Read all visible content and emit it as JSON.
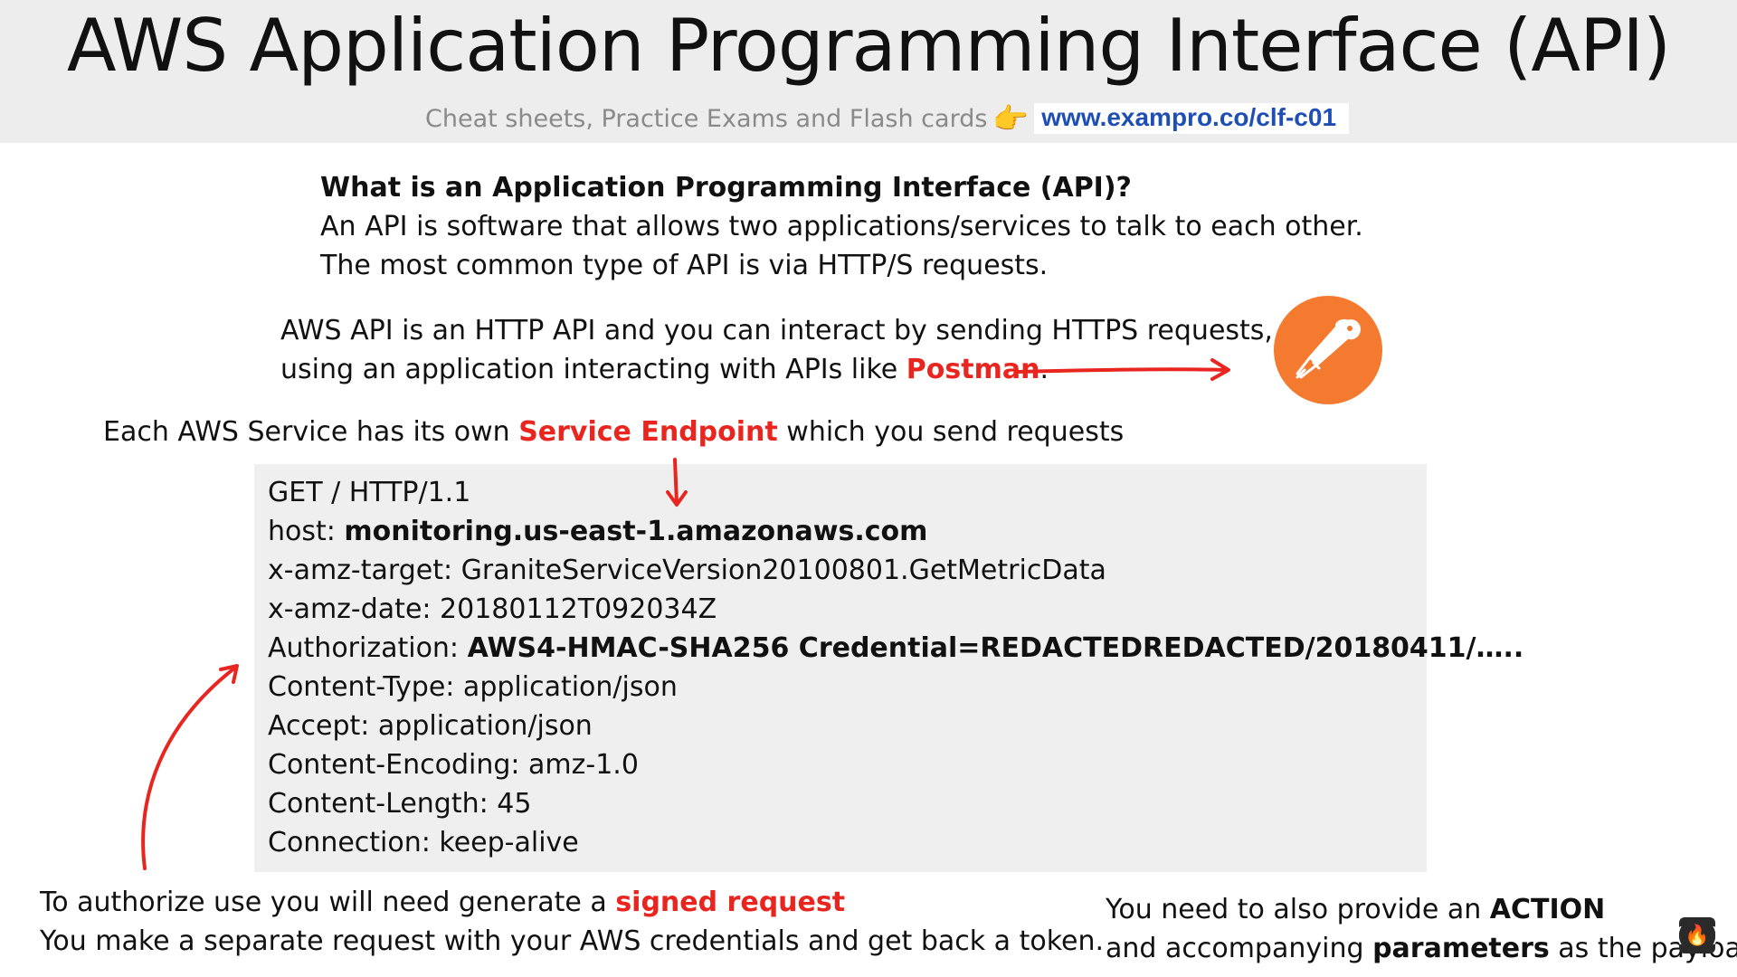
{
  "header": {
    "title": "AWS Application Programming Interface (API)",
    "subtitle": "Cheat sheets, Practice Exams and Flash cards",
    "link": "www.exampro.co/clf-c01"
  },
  "intro": {
    "heading": "What is an Application Programming Interface (API)?",
    "line1": "An API is software that allows two applications/services to talk to each other.",
    "line2": "The most common type of API is via HTTP/S requests."
  },
  "aws_api": {
    "line1": "AWS API is an HTTP API and you can interact by sending HTTPS requests,",
    "line2_prefix": "using an application interacting with APIs like ",
    "line2_highlight": "Postman",
    "line2_suffix": "."
  },
  "service": {
    "prefix": "Each AWS Service has its own ",
    "highlight": "Service Endpoint",
    "suffix": " which you send requests"
  },
  "request": {
    "line1": "GET / HTTP/1.1",
    "host_label": "host: ",
    "host_value": "monitoring.us-east-1.amazonaws.com",
    "target": "x-amz-target: GraniteServiceVersion20100801.GetMetricData",
    "date": "x-amz-date: 20180112T092034Z",
    "auth_label": "Authorization: ",
    "auth_value": "AWS4-HMAC-SHA256 Credential=REDACTEDREDACTED/20180411/…..",
    "content_type": "Content-Type: application/json",
    "accept": "Accept: application/json",
    "encoding": "Content-Encoding: amz-1.0",
    "length": "Content-Length: 45",
    "connection": "Connection: keep-alive"
  },
  "authorize": {
    "line1_prefix": "To authorize use you will need generate a ",
    "line1_highlight": "signed request",
    "line2": "You make a separate request with your AWS credentials and get back a token."
  },
  "action": {
    "line1_prefix": "You need to also provide an ",
    "line1_bold": "ACTION",
    "line2_prefix": "and accompanying ",
    "line2_bold": "parameters",
    "line2_suffix": " as the payload"
  },
  "icons": {
    "postman": "postman-logo-icon",
    "pointing_hand": "pointing-hand-icon",
    "corner": "freecodecamp-logo-icon"
  },
  "colors": {
    "highlight_red": "#e8261f",
    "link_blue": "#1f4fb5",
    "postman_orange": "#f47a30",
    "code_bg": "#efefef",
    "header_bg": "#ededed"
  }
}
